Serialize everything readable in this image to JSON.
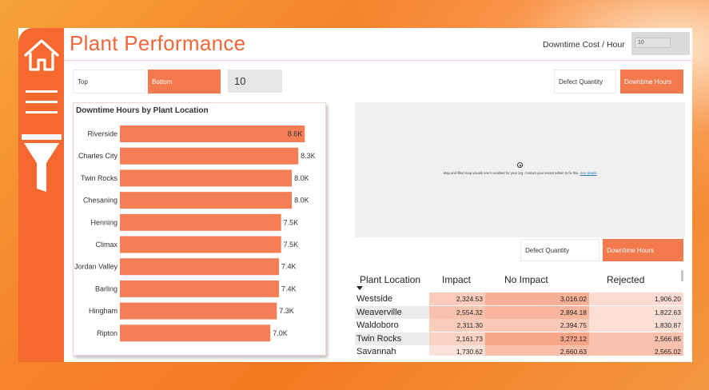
{
  "header": {
    "title": "Plant Performance",
    "cost_label": "Downtime Cost / Hour",
    "cost_value": "10"
  },
  "filters": {
    "top_label": "Top",
    "bottom_label": "Bottom",
    "count_value": "10",
    "defect_label": "Defect Quantity",
    "downtime_label": "Downtime Hours"
  },
  "map": {
    "message": "Map and filled map visuals aren't enabled for your org. Contact your tenant admin to fix this.",
    "link": "See details"
  },
  "lower_toggle": {
    "defect_label": "Defect Quantity",
    "downtime_label": "Downtime Hours"
  },
  "colors": {
    "accent": "#f5692f",
    "bar": "#f47f57"
  },
  "chart_data": {
    "type": "bar",
    "orientation": "horizontal",
    "title": "Downtime Hours by Plant Location",
    "categories": [
      "Riverside",
      "Charles City",
      "Twin Rocks",
      "Chesaning",
      "Henning",
      "Climax",
      "Jordan Valley",
      "Barling",
      "Hingham",
      "Ripton"
    ],
    "values": [
      8.6,
      8.3,
      8.0,
      8.0,
      7.5,
      7.5,
      7.4,
      7.4,
      7.3,
      7.0
    ],
    "labels": [
      "8.6K",
      "8.3K",
      "8.0K",
      "8.0K",
      "7.5K",
      "7.5K",
      "7.4K",
      "7.4K",
      "7.3K",
      "7.0K"
    ],
    "unit": "K"
  },
  "table": {
    "columns": [
      "Plant Location",
      "Impact",
      "No Impact",
      "Rejected"
    ],
    "rows": [
      {
        "loc": "Westside",
        "impact": "2,324.53",
        "no_impact": "3,016.02",
        "rejected": "1,906.20"
      },
      {
        "loc": "Weaverville",
        "impact": "2,554.32",
        "no_impact": "2,894.18",
        "rejected": "1,822.63"
      },
      {
        "loc": "Waldoboro",
        "impact": "2,311.30",
        "no_impact": "2,394.75",
        "rejected": "1,830.87"
      },
      {
        "loc": "Twin Rocks",
        "impact": "2,161.73",
        "no_impact": "3,272.12",
        "rejected": "2,566.85"
      },
      {
        "loc": "Savannah",
        "impact": "1,730.62",
        "no_impact": "2,660.63",
        "rejected": "2,565.02"
      }
    ]
  }
}
